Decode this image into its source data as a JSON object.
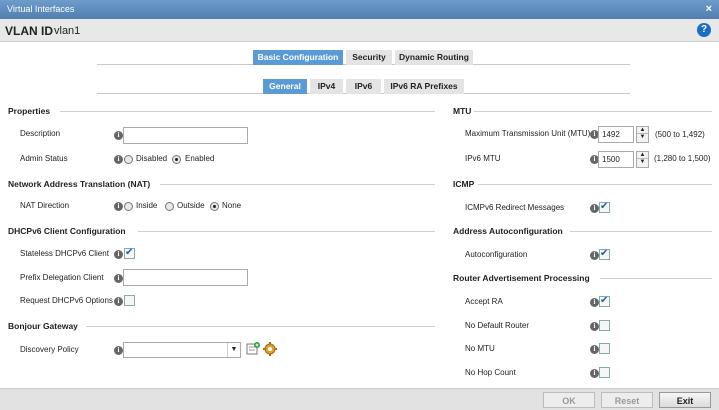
{
  "window": {
    "title": "Virtual Interfaces",
    "close_glyph": "×"
  },
  "vlan": {
    "label": "VLAN ID",
    "value": "vlan1",
    "help_glyph": "?"
  },
  "tabs_main": [
    {
      "label": "Basic Configuration",
      "active": true
    },
    {
      "label": "Security",
      "active": false
    },
    {
      "label": "Dynamic Routing",
      "active": false
    }
  ],
  "tabs_sub": [
    {
      "label": "General",
      "active": true
    },
    {
      "label": "IPv4",
      "active": false
    },
    {
      "label": "IPv6",
      "active": false
    },
    {
      "label": "IPv6 RA Prefixes",
      "active": false
    }
  ],
  "left": {
    "properties": {
      "title": "Properties",
      "description_label": "Description",
      "description_value": "",
      "admin_status_label": "Admin Status",
      "admin_options": [
        "Disabled",
        "Enabled"
      ],
      "admin_selected": "Enabled"
    },
    "nat": {
      "title": "Network Address Translation (NAT)",
      "direction_label": "NAT Direction",
      "options": [
        "Inside",
        "Outside",
        "None"
      ],
      "selected": "None"
    },
    "dhcpv6": {
      "title": "DHCPv6 Client Configuration",
      "stateless_label": "Stateless DHCPv6 Client",
      "stateless_checked": true,
      "prefix_label": "Prefix Delegation Client",
      "prefix_value": "",
      "request_label": "Request DHCPv6 Options",
      "request_checked": false
    },
    "bonjour": {
      "title": "Bonjour Gateway",
      "discovery_label": "Discovery Policy",
      "discovery_value": ""
    }
  },
  "right": {
    "mtu": {
      "title": "MTU",
      "max_label": "Maximum Transmission Unit (MTU)",
      "max_value": "1492",
      "max_range": "(500 to 1,492)",
      "ipv6_label": "IPv6 MTU",
      "ipv6_value": "1500",
      "ipv6_range": "(1,280 to 1,500)"
    },
    "icmp": {
      "title": "ICMP",
      "redirect_label": "ICMPv6 Redirect Messages",
      "redirect_checked": true
    },
    "autoconf": {
      "title": "Address Autoconfiguration",
      "label": "Autoconfiguration",
      "checked": true
    },
    "rap": {
      "title": "Router Advertisement Processing",
      "items": [
        {
          "label": "Accept RA",
          "checked": true
        },
        {
          "label": "No Default Router",
          "checked": false
        },
        {
          "label": "No MTU",
          "checked": false
        },
        {
          "label": "No Hop Count",
          "checked": false
        }
      ]
    }
  },
  "footer": {
    "ok": "OK",
    "reset": "Reset",
    "exit": "Exit"
  },
  "icons": {
    "info": "i",
    "spin_up": "▲",
    "spin_down": "▼",
    "select_arrow": "▼"
  },
  "colors": {
    "title_bar": "#5a88b8",
    "active_tab": "#5b9bd5",
    "help": "#1c6dc2"
  }
}
